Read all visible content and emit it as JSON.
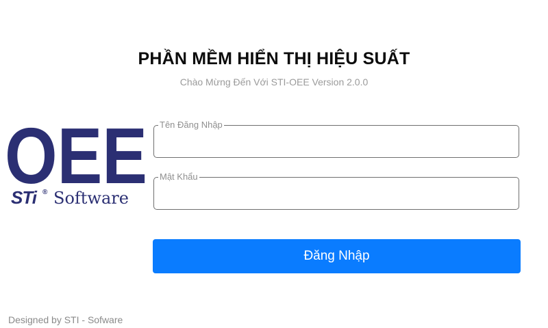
{
  "header": {
    "title": "PHẦN MỀM HIỂN THỊ HIỆU SUẤT",
    "subtitle": "Chào Mừng Đến Với STI-OEE Version 2.0.0"
  },
  "logo": {
    "oee_text": "OEE",
    "brand_text": "STi",
    "registered_mark": "®",
    "software_text": "Software",
    "color": "#2b2f73"
  },
  "form": {
    "username_label": "Tên Đăng Nhập",
    "username_value": "",
    "password_label": "Mật Khẩu",
    "password_value": "",
    "login_label": "Đăng Nhập"
  },
  "footer": {
    "text": "Designed by STI - Sofware"
  },
  "colors": {
    "accent": "#0a7cff",
    "logo": "#2b2f73"
  }
}
